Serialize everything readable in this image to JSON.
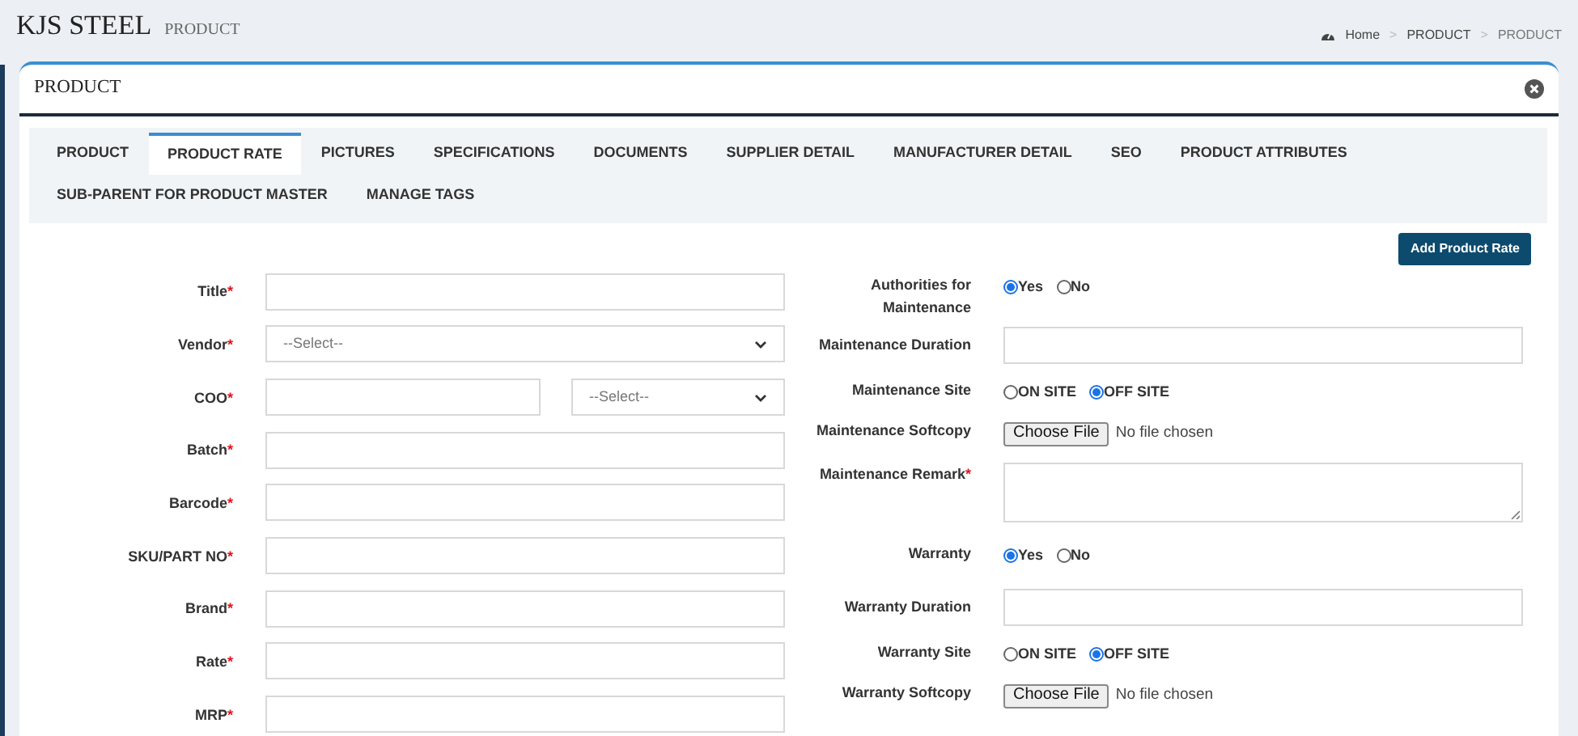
{
  "header": {
    "title": "KJS STEEL",
    "subtitle": "PRODUCT"
  },
  "breadcrumb": {
    "separator": ">",
    "items": [
      "Home",
      "PRODUCT",
      "PRODUCT"
    ]
  },
  "card": {
    "title": "PRODUCT"
  },
  "tabs": [
    {
      "label": "PRODUCT",
      "selected": false
    },
    {
      "label": "PRODUCT RATE",
      "selected": true
    },
    {
      "label": "PICTURES",
      "selected": false
    },
    {
      "label": "SPECIFICATIONS",
      "selected": false
    },
    {
      "label": "DOCUMENTS",
      "selected": false
    },
    {
      "label": "SUPPLIER DETAIL",
      "selected": false
    },
    {
      "label": "MANUFACTURER DETAIL",
      "selected": false
    },
    {
      "label": "SEO",
      "selected": false
    },
    {
      "label": "PRODUCT ATTRIBUTES",
      "selected": false
    },
    {
      "label": "SUB-PARENT FOR PRODUCT MASTER",
      "selected": false
    },
    {
      "label": "MANAGE TAGS",
      "selected": false
    }
  ],
  "add_button": "Add Product Rate",
  "required_marker": "*",
  "left_fields": [
    {
      "kind": "text",
      "label": "Title",
      "required": true
    },
    {
      "kind": "select",
      "label": "Vendor",
      "required": true,
      "value": "--Select--"
    },
    {
      "kind": "split",
      "label": "COO",
      "required": true,
      "value": "--Select--"
    },
    {
      "kind": "text",
      "label": "Batch",
      "required": true
    },
    {
      "kind": "text",
      "label": "Barcode",
      "required": true
    },
    {
      "kind": "text",
      "label": "SKU/PART NO",
      "required": true
    },
    {
      "kind": "text",
      "label": "Brand",
      "required": true
    },
    {
      "kind": "text",
      "label": "Rate",
      "required": true
    },
    {
      "kind": "text",
      "label": "MRP",
      "required": true
    }
  ],
  "right_fields": [
    {
      "kind": "radio",
      "label": "Authorities for Maintenance",
      "required": false,
      "options": [
        {
          "label": "Yes",
          "selected": true
        },
        {
          "label": "No",
          "selected": false
        }
      ]
    },
    {
      "kind": "text",
      "label": "Maintenance Duration",
      "required": false
    },
    {
      "kind": "radio",
      "label": "Maintenance Site",
      "required": false,
      "options": [
        {
          "label": "ON SITE",
          "selected": false
        },
        {
          "label": "OFF SITE",
          "selected": true
        }
      ]
    },
    {
      "kind": "file",
      "label": "Maintenance Softcopy",
      "required": false,
      "button": "Choose File",
      "status": "No file chosen"
    },
    {
      "kind": "textarea",
      "label": "Maintenance Remark",
      "required": true
    },
    {
      "kind": "radio",
      "label": "Warranty",
      "required": false,
      "options": [
        {
          "label": "Yes",
          "selected": true
        },
        {
          "label": "No",
          "selected": false
        }
      ]
    },
    {
      "kind": "text",
      "label": "Warranty Duration",
      "required": false
    },
    {
      "kind": "radio",
      "label": "Warranty Site",
      "required": false,
      "options": [
        {
          "label": "ON SITE",
          "selected": false
        },
        {
          "label": "OFF SITE",
          "selected": true
        }
      ]
    },
    {
      "kind": "file",
      "label": "Warranty Softcopy",
      "required": false,
      "button": "Choose File",
      "status": "No file chosen"
    }
  ]
}
